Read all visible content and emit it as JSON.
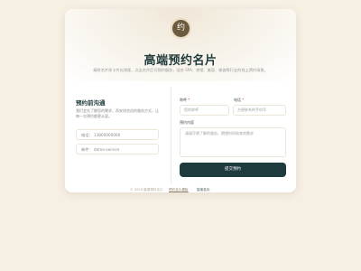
{
  "header": {
    "logo_char": "约",
    "title": "高端预约名片",
    "subtitle": "精致名片样卡片化排版，点击名片后可预约服务，适合 SPA、茶馆、美容、瑜伽等行业的线上预约场景。"
  },
  "contact": {
    "title": "预约前沟通",
    "description": "我们会先了解您的需求，再安排合适的服务方式，让每一次预约都更从容。",
    "phone": {
      "label": "电话",
      "value": "13800000000"
    },
    "email": {
      "label": "邮件",
      "value": "demo-service"
    }
  },
  "form": {
    "name_label": "称呼",
    "name_placeholder": "您的称呼",
    "phone_label": "电话",
    "phone_placeholder": "方便联系的手机号",
    "message_label": "预约内容",
    "message_placeholder": "请填写想了解的服务、期望时间和其他需求",
    "required_mark": "*",
    "submit_label": "提交预约"
  },
  "footer": {
    "copyright": "© 2026 高端预约名片",
    "link_text": "预约名片模板",
    "tech_prefix": "技术支持：",
    "tech_brand": "智能名片"
  },
  "colors": {
    "background": "#f6efe3",
    "primary": "#1f3a3d",
    "logo": "#6b5a3e"
  }
}
